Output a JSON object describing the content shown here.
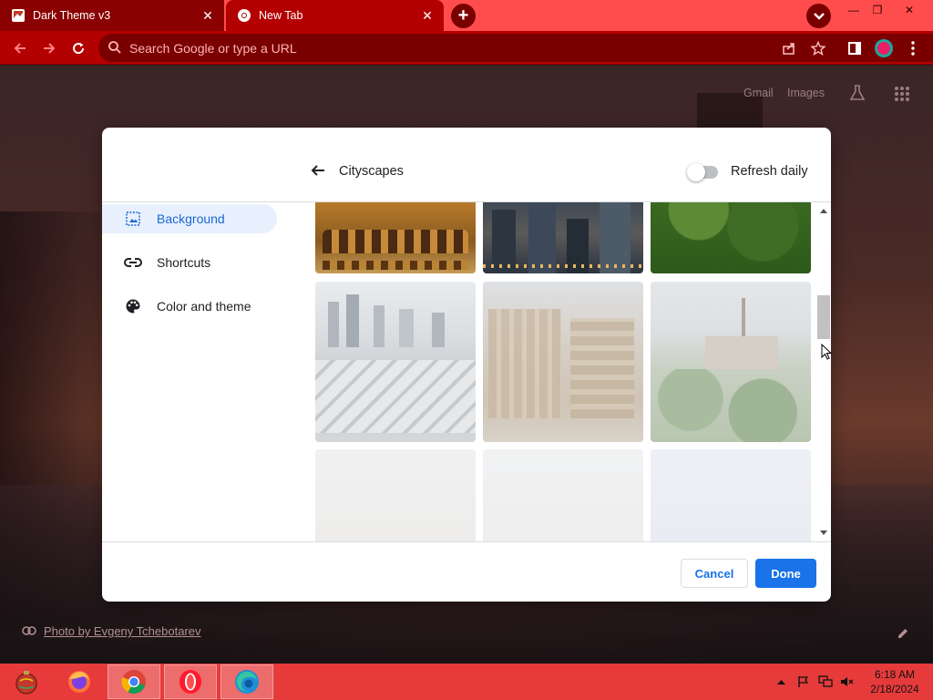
{
  "browser": {
    "tabs": [
      {
        "title": "Dark Theme v3",
        "active": false
      },
      {
        "title": "New Tab",
        "active": true
      }
    ],
    "omnibox_placeholder": "Search Google or type a URL"
  },
  "ntp": {
    "links": [
      "Gmail",
      "Images"
    ],
    "photo_credit": "Photo by Evgeny Tchebotarev"
  },
  "dialog": {
    "title": "Cityscapes",
    "refresh_label": "Refresh daily",
    "refresh_enabled": false,
    "menu": [
      {
        "label": "Background",
        "icon": "image-icon",
        "selected": true
      },
      {
        "label": "Shortcuts",
        "icon": "link-icon",
        "selected": false
      },
      {
        "label": "Color and theme",
        "icon": "palette-icon",
        "selected": false
      }
    ],
    "cancel_label": "Cancel",
    "done_label": "Done"
  },
  "taskbar": {
    "apps": [
      "ornament-app-icon",
      "firefox-icon",
      "chrome-icon",
      "opera-icon",
      "edge-icon"
    ],
    "time": "6:18 AM",
    "date": "2/18/2024"
  },
  "colors": {
    "tabstrip": "#ff4d4d",
    "toolbar": "#b30000",
    "accent_blue": "#1a73e8",
    "taskbar": "#e73b3b"
  }
}
